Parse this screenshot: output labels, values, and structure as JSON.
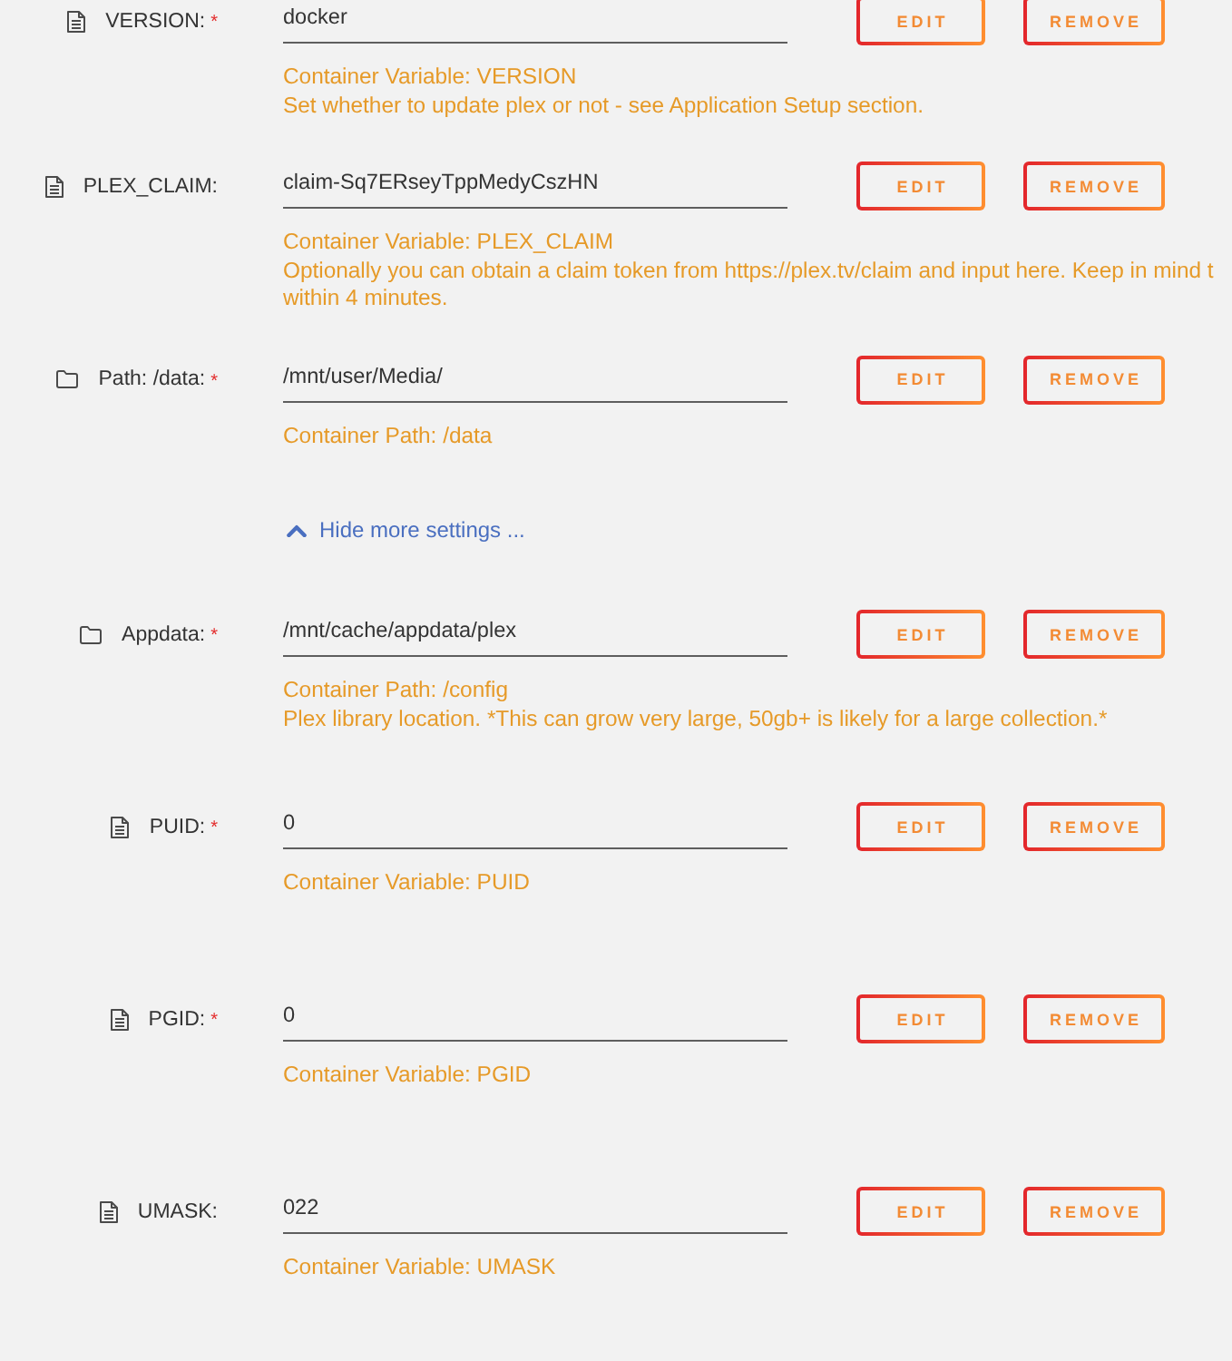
{
  "settings": [
    {
      "kind": "variable",
      "label": "VERSION:",
      "required_mark": "*",
      "value": "docker",
      "description": [
        "Container Variable: VERSION",
        "Set whether to update plex or not - see Application Setup section."
      ],
      "buttons": [
        {
          "kind": "edit",
          "label": "EDIT"
        },
        {
          "kind": "remove",
          "label": "REMOVE"
        }
      ]
    },
    {
      "kind": "variable",
      "label": "PLEX_CLAIM:",
      "value": "claim-Sq7ERseyTppMedyCszHN",
      "description": [
        "Container Variable: PLEX_CLAIM",
        "Optionally you can obtain a claim token from https://plex.tv/claim and input here. Keep in mind t",
        "within 4 minutes."
      ],
      "buttons": [
        {
          "kind": "edit",
          "label": "EDIT"
        },
        {
          "kind": "remove",
          "label": "REMOVE"
        }
      ]
    },
    {
      "kind": "path",
      "label": "Path: /data:",
      "required_mark": "*",
      "value": "/mnt/user/Media/",
      "description": [
        "Container Path: /data"
      ],
      "buttons": [
        {
          "kind": "edit",
          "label": "EDIT"
        },
        {
          "kind": "remove",
          "label": "REMOVE"
        }
      ]
    }
  ],
  "more_settings_toggle": {
    "label": "Hide more settings ...",
    "expanded": true
  },
  "more_settings": [
    {
      "kind": "path",
      "label": "Appdata:",
      "required_mark": "*",
      "value": "/mnt/cache/appdata/plex",
      "description": [
        "Container Path: /config",
        "Plex library location. *This can grow very large, 50gb+ is likely for a large collection.*"
      ],
      "buttons": [
        {
          "kind": "edit",
          "label": "EDIT"
        },
        {
          "kind": "remove",
          "label": "REMOVE"
        }
      ]
    },
    {
      "kind": "variable",
      "label": "PUID:",
      "required_mark": "*",
      "value": "0",
      "description": [
        "Container Variable: PUID"
      ],
      "buttons": [
        {
          "kind": "edit",
          "label": "EDIT"
        },
        {
          "kind": "remove",
          "label": "REMOVE"
        }
      ]
    },
    {
      "kind": "variable",
      "label": "PGID:",
      "required_mark": "*",
      "value": "0",
      "description": [
        "Container Variable: PGID"
      ],
      "buttons": [
        {
          "kind": "edit",
          "label": "EDIT"
        },
        {
          "kind": "remove",
          "label": "REMOVE"
        }
      ]
    },
    {
      "kind": "variable",
      "label": "UMASK:",
      "value": "022",
      "description": [
        "Container Variable: UMASK"
      ],
      "buttons": [
        {
          "kind": "edit",
          "label": "EDIT"
        },
        {
          "kind": "remove",
          "label": "REMOVE"
        }
      ]
    }
  ]
}
